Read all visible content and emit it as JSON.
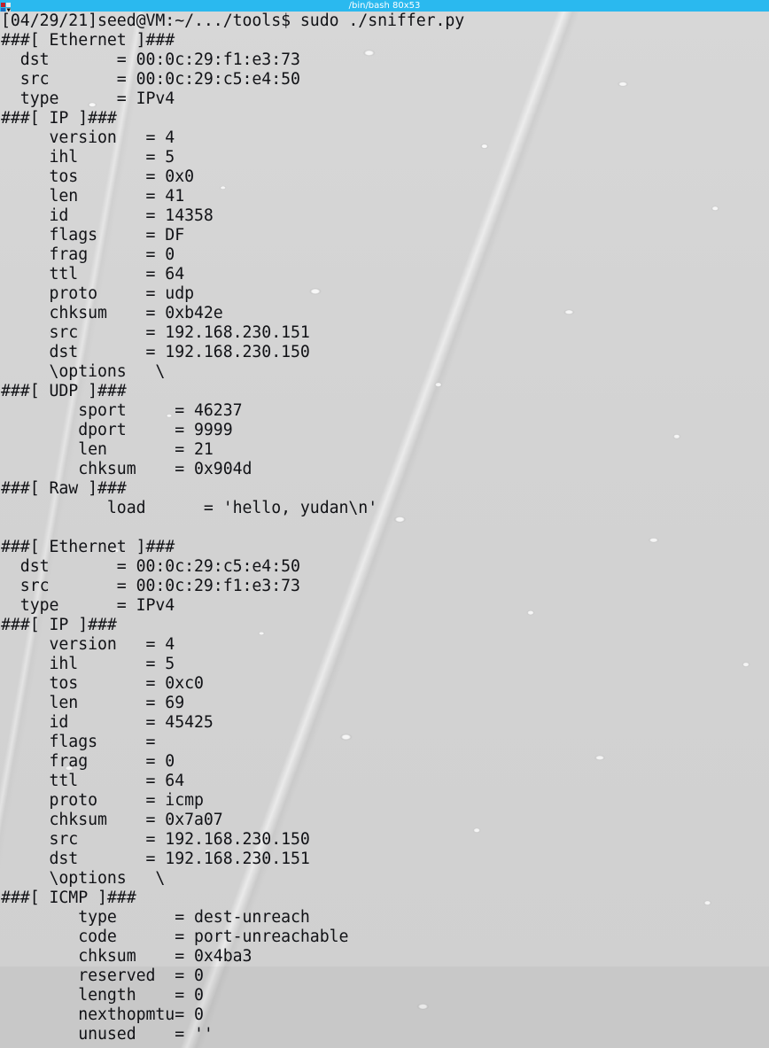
{
  "window": {
    "title": "/bin/bash 80x53",
    "menu_icon": "window-menu-icon",
    "titlebar_color": "#2ab9ef",
    "background_color": "#d2d2d2",
    "text_color": "#111216"
  },
  "terminal": {
    "prompt_line": "[04/29/21]seed@VM:~/.../tools$ sudo ./sniffer.py",
    "prompt": "[04/29/21]seed@VM:~/.../tools$",
    "command": "sudo ./sniffer.py",
    "lines": [
      "[04/29/21]seed@VM:~/.../tools$ sudo ./sniffer.py",
      "###[ Ethernet ]###",
      "  dst       = 00:0c:29:f1:e3:73",
      "  src       = 00:0c:29:c5:e4:50",
      "  type      = IPv4",
      "###[ IP ]###",
      "     version   = 4",
      "     ihl       = 5",
      "     tos       = 0x0",
      "     len       = 41",
      "     id        = 14358",
      "     flags     = DF",
      "     frag      = 0",
      "     ttl       = 64",
      "     proto     = udp",
      "     chksum    = 0xb42e",
      "     src       = 192.168.230.151",
      "     dst       = 192.168.230.150",
      "     \\options   \\",
      "###[ UDP ]###",
      "        sport     = 46237",
      "        dport     = 9999",
      "        len       = 21",
      "        chksum    = 0x904d",
      "###[ Raw ]###",
      "           load      = 'hello, yudan\\n'",
      "",
      "###[ Ethernet ]###",
      "  dst       = 00:0c:29:c5:e4:50",
      "  src       = 00:0c:29:f1:e3:73",
      "  type      = IPv4",
      "###[ IP ]###",
      "     version   = 4",
      "     ihl       = 5",
      "     tos       = 0xc0",
      "     len       = 69",
      "     id        = 45425",
      "     flags     =",
      "     frag      = 0",
      "     ttl       = 64",
      "     proto     = icmp",
      "     chksum    = 0x7a07",
      "     src       = 192.168.230.150",
      "     dst       = 192.168.230.151",
      "     \\options   \\",
      "###[ ICMP ]###",
      "        type      = dest-unreach",
      "        code      = port-unreachable",
      "        chksum    = 0x4ba3",
      "        reserved  = 0",
      "        length    = 0",
      "        nexthopmtu= 0",
      "        unused    = ''"
    ],
    "packets": [
      {
        "layers": [
          {
            "name": "Ethernet",
            "header": "###[ Ethernet ]###",
            "fields": [
              {
                "key": "dst",
                "value": "00:0c:29:f1:e3:73"
              },
              {
                "key": "src",
                "value": "00:0c:29:c5:e4:50"
              },
              {
                "key": "type",
                "value": "IPv4"
              }
            ]
          },
          {
            "name": "IP",
            "header": "###[ IP ]###",
            "fields": [
              {
                "key": "version",
                "value": "4"
              },
              {
                "key": "ihl",
                "value": "5"
              },
              {
                "key": "tos",
                "value": "0x0"
              },
              {
                "key": "len",
                "value": "41"
              },
              {
                "key": "id",
                "value": "14358"
              },
              {
                "key": "flags",
                "value": "DF"
              },
              {
                "key": "frag",
                "value": "0"
              },
              {
                "key": "ttl",
                "value": "64"
              },
              {
                "key": "proto",
                "value": "udp"
              },
              {
                "key": "chksum",
                "value": "0xb42e"
              },
              {
                "key": "src",
                "value": "192.168.230.151"
              },
              {
                "key": "dst",
                "value": "192.168.230.150"
              },
              {
                "key": "\\options",
                "value": "\\"
              }
            ]
          },
          {
            "name": "UDP",
            "header": "###[ UDP ]###",
            "fields": [
              {
                "key": "sport",
                "value": "46237"
              },
              {
                "key": "dport",
                "value": "9999"
              },
              {
                "key": "len",
                "value": "21"
              },
              {
                "key": "chksum",
                "value": "0x904d"
              }
            ]
          },
          {
            "name": "Raw",
            "header": "###[ Raw ]###",
            "fields": [
              {
                "key": "load",
                "value": "'hello, yudan\\n'"
              }
            ]
          }
        ]
      },
      {
        "layers": [
          {
            "name": "Ethernet",
            "header": "###[ Ethernet ]###",
            "fields": [
              {
                "key": "dst",
                "value": "00:0c:29:c5:e4:50"
              },
              {
                "key": "src",
                "value": "00:0c:29:f1:e3:73"
              },
              {
                "key": "type",
                "value": "IPv4"
              }
            ]
          },
          {
            "name": "IP",
            "header": "###[ IP ]###",
            "fields": [
              {
                "key": "version",
                "value": "4"
              },
              {
                "key": "ihl",
                "value": "5"
              },
              {
                "key": "tos",
                "value": "0xc0"
              },
              {
                "key": "len",
                "value": "69"
              },
              {
                "key": "id",
                "value": "45425"
              },
              {
                "key": "flags",
                "value": ""
              },
              {
                "key": "frag",
                "value": "0"
              },
              {
                "key": "ttl",
                "value": "64"
              },
              {
                "key": "proto",
                "value": "icmp"
              },
              {
                "key": "chksum",
                "value": "0x7a07"
              },
              {
                "key": "src",
                "value": "192.168.230.150"
              },
              {
                "key": "dst",
                "value": "192.168.230.151"
              },
              {
                "key": "\\options",
                "value": "\\"
              }
            ]
          },
          {
            "name": "ICMP",
            "header": "###[ ICMP ]###",
            "fields": [
              {
                "key": "type",
                "value": "dest-unreach"
              },
              {
                "key": "code",
                "value": "port-unreachable"
              },
              {
                "key": "chksum",
                "value": "0x4ba3"
              },
              {
                "key": "reserved",
                "value": "0"
              },
              {
                "key": "length",
                "value": "0"
              },
              {
                "key": "nexthopmtu",
                "value": "0"
              },
              {
                "key": "unused",
                "value": "''"
              }
            ]
          }
        ]
      }
    ]
  }
}
